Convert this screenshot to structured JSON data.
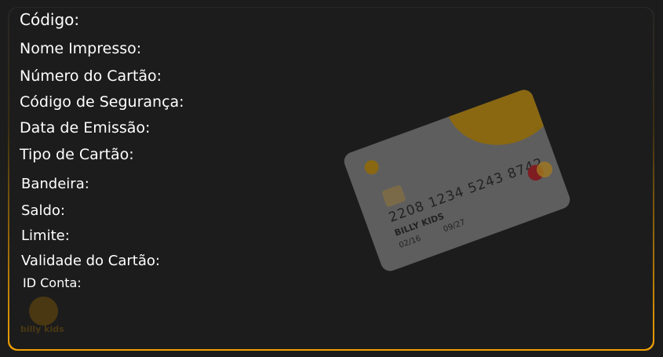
{
  "fields": [
    {
      "label": "Código:"
    },
    {
      "label": "Nome Impresso:"
    },
    {
      "label": "Número do Cartão:"
    },
    {
      "label": "Código de Segurança:"
    },
    {
      "label": "Data de Emissão:"
    },
    {
      "label": "Tipo de Cartão:"
    },
    {
      "label": "Bandeira:"
    },
    {
      "label": "Saldo:"
    },
    {
      "label": "Limite:"
    },
    {
      "label": "Validade do Cartão:"
    },
    {
      "label": "ID Conta:"
    }
  ],
  "card": {
    "number": "2208 1234 5243 8742",
    "holder": "BILLY KIDS",
    "issued": "02/16",
    "expires": "09/27"
  },
  "brand": {
    "logo_text": "billy kids"
  },
  "colors": {
    "accent": "#f0a000",
    "background": "#1c1c1c"
  }
}
